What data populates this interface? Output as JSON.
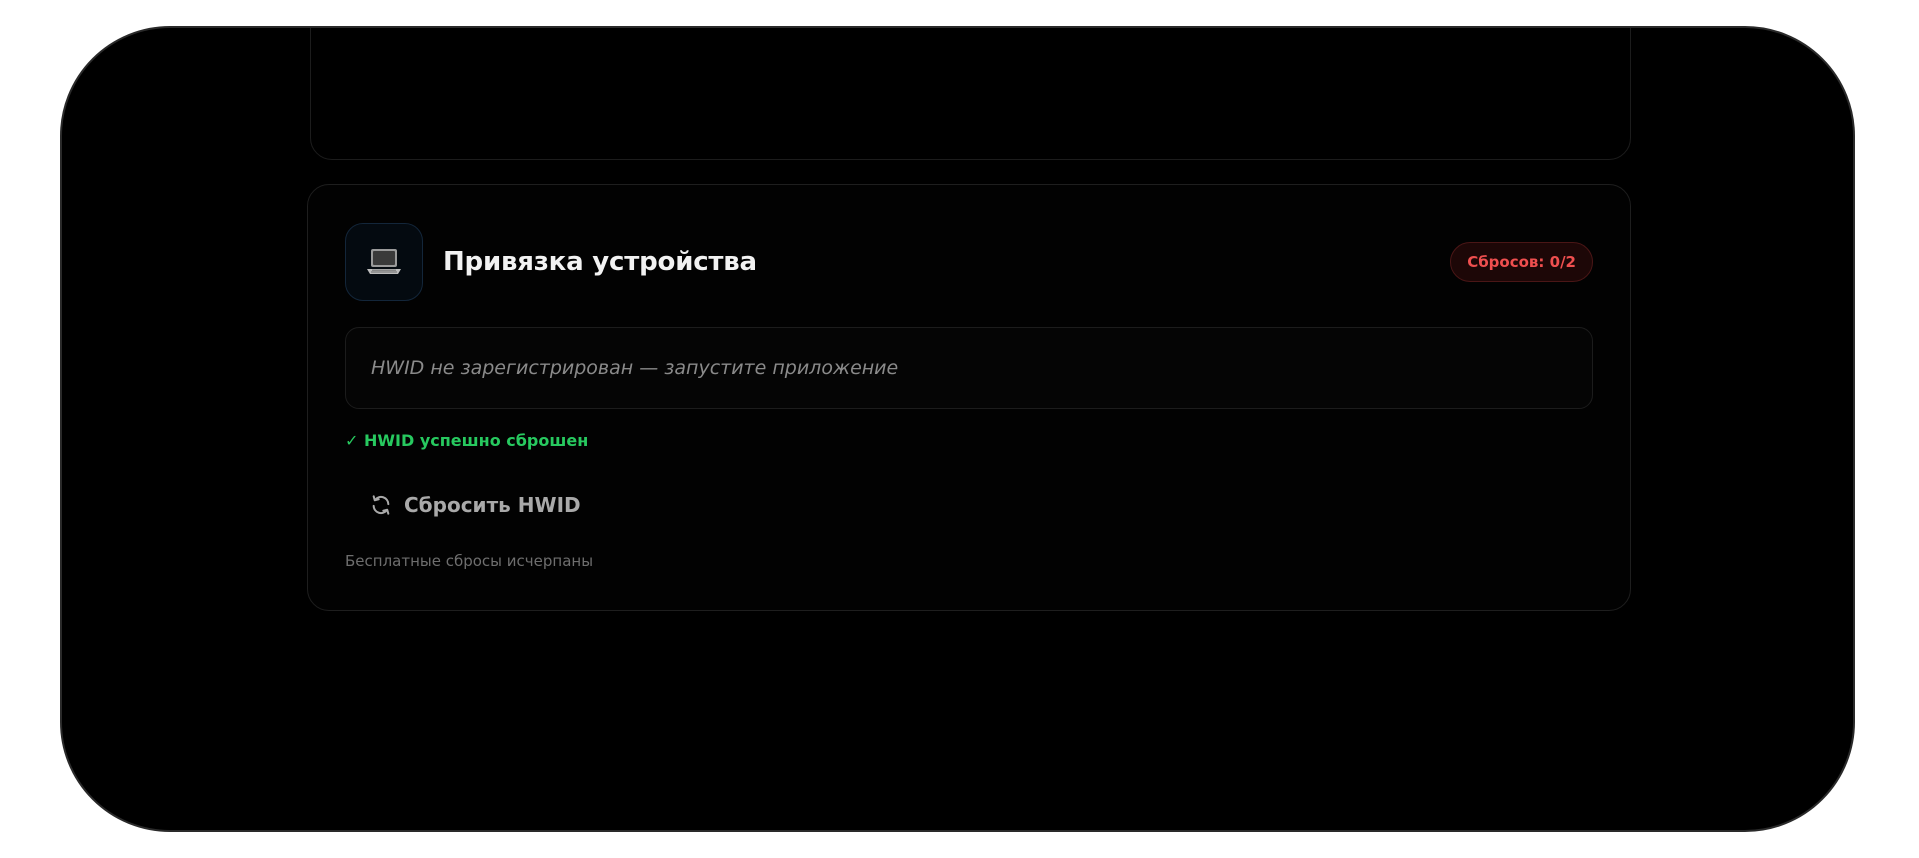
{
  "device_card": {
    "icon": "laptop-icon",
    "title": "Привязка устройства",
    "badge": "Сбросов: 0/2",
    "hwid_status": "HWID не зарегистрирован — запустите приложение",
    "success_message": "✓ HWID успешно сброшен",
    "reset_icon": "refresh-icon",
    "reset_button_label": "Сбросить HWID",
    "footnote": "Бесплатные сбросы исчерпаны"
  },
  "colors": {
    "background": "#000000",
    "badge_text": "#ef4f4f",
    "badge_bg": "#1d0707",
    "success": "#27c95f",
    "title": "#f2f2f2",
    "muted": "#8a8a8a"
  }
}
